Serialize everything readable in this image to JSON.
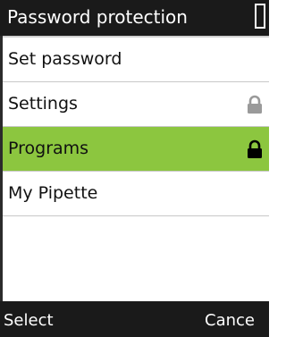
{
  "title_bar": {
    "title": "Password protection",
    "battery_icon": "battery-icon"
  },
  "menu": {
    "items": [
      {
        "label": "Set password",
        "icon": null,
        "selected": false
      },
      {
        "label": "Settings",
        "icon": "lock-icon",
        "icon_color": "#9a9a9a",
        "selected": false
      },
      {
        "label": "Programs",
        "icon": "lock-icon",
        "icon_color": "#000000",
        "selected": true
      },
      {
        "label": "My Pipette",
        "icon": null,
        "selected": false
      }
    ]
  },
  "softkeys": {
    "left": "Select",
    "right": "Cance"
  },
  "colors": {
    "bar_background": "#1a1a1a",
    "selection": "#8cc63f",
    "divider": "#c8c8c8"
  }
}
